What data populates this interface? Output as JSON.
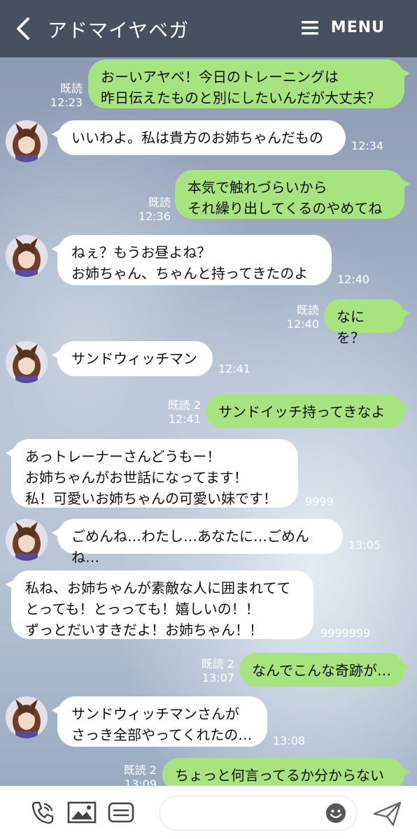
{
  "header": {
    "title": "アドマイヤベガ",
    "menu_label": "MENU"
  },
  "messages": [
    {
      "side": "out",
      "text": "おーいアヤベ！今日のトレーニングは\n昨日伝えたものと別にしたいんだが大丈夫？",
      "read": "既読",
      "time": "12:23"
    },
    {
      "side": "in",
      "text": "いいわよ。私は貴方のお姉ちゃんだもの",
      "time": "12:34"
    },
    {
      "side": "out",
      "text": "本気で触れづらいから\nそれ繰り出してくるのやめてね",
      "read": "既読",
      "time": "12:36"
    },
    {
      "side": "in",
      "text": "ねぇ？もうお昼よね？\nお姉ちゃん、ちゃんと持ってきたのよ",
      "time": "12:40"
    },
    {
      "side": "out",
      "text": "なにを？",
      "read": "既読",
      "time": "12:40"
    },
    {
      "side": "in",
      "text": "サンドウィッチマン",
      "time": "12:41"
    },
    {
      "side": "out",
      "text": "サンドイッチ持ってきなよ",
      "read": "既読 2",
      "time": "12:41"
    },
    {
      "side": "in",
      "text": "あっトレーナーさんどうもー！\nお姉ちゃんがお世話になってます！\n私！可愛いお姉ちゃんの可愛い妹です！",
      "time": "9999"
    },
    {
      "side": "in",
      "text": "ごめんね…わたし…あなたに…ごめんね…",
      "time": "13:05"
    },
    {
      "side": "in",
      "text": "私ね、お姉ちゃんが素敵な人に囲まれてて\nとっても！とっっても！嬉しいの！！\nずっとだいすきだよ！お姉ちゃん！！",
      "time": "9999999"
    },
    {
      "side": "out",
      "text": "なんでこんな奇跡が…",
      "read": "既読 2",
      "time": "13:07"
    },
    {
      "side": "in",
      "text": "サンドウィッチマンさんが\nさっき全部やってくれたの…",
      "time": "13:08"
    },
    {
      "side": "out",
      "text": "ちょっと何言ってるか分からない",
      "read": "既読 2",
      "time": "13:09"
    }
  ],
  "icons": [
    "back-arrow-icon",
    "menu-icon",
    "phone-icon",
    "image-icon",
    "keep-icon",
    "smiley-icon",
    "send-icon"
  ]
}
